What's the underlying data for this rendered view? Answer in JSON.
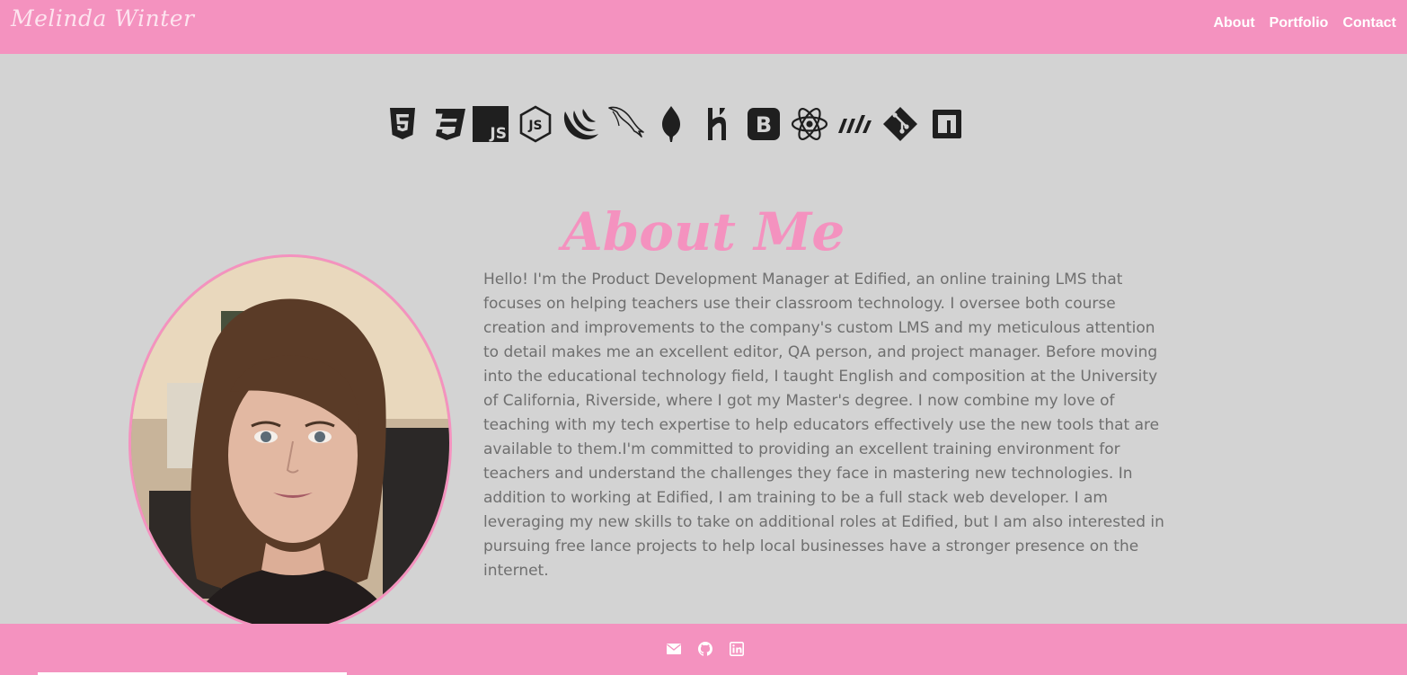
{
  "header": {
    "brand": "Melinda Winter",
    "nav": [
      {
        "label": "About"
      },
      {
        "label": "Portfolio"
      },
      {
        "label": "Contact"
      }
    ]
  },
  "skills": [
    "html5-icon",
    "css3-icon",
    "javascript-icon",
    "nodejs-icon",
    "jquery-icon",
    "mysql-icon",
    "mongodb-icon",
    "heroku-icon",
    "bootstrap-icon",
    "react-icon",
    "materialize-icon",
    "git-icon",
    "npm-icon"
  ],
  "about": {
    "title": "About Me",
    "photo_icon": "profile-photo",
    "bio": "Hello! I'm the Product Development Manager at Edified, an online training LMS that focuses on helping teachers use their classroom technology. I oversee both course creation and improvements to the company's custom LMS and my meticulous attention to detail makes me an excellent editor, QA person, and project manager. Before moving into the educational technology field, I taught English and composition at the University of California, Riverside, where I got my Master's degree. I now combine my love of teaching with my tech expertise to help educators effectively use the new tools that are available to them.I'm committed to providing an excellent training environment for teachers and understand the challenges they face in mastering new technologies. In addition to working at Edified, I am training to be a full stack web developer. I am leveraging my new skills to take on additional roles at Edified, but I am also interested in pursuing free lance projects to help local businesses have a stronger presence on the internet."
  },
  "footer": {
    "icons": [
      "envelope-icon",
      "github-icon",
      "linkedin-icon"
    ]
  },
  "colors": {
    "accent": "#f492bf",
    "background": "#d3d3d3",
    "text": "#6f6f6f",
    "icon": "#1f1f1f"
  }
}
